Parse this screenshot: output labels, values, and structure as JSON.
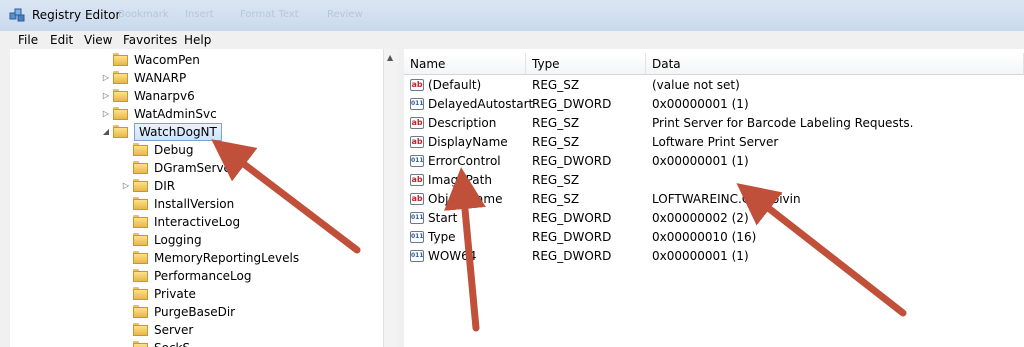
{
  "window": {
    "title": "Registry Editor",
    "ghost_tabs": [
      "Bookmark",
      "Insert",
      "Format Text",
      "Review"
    ]
  },
  "menu": [
    "File",
    "Edit",
    "View",
    "Favorites",
    "Help"
  ],
  "tree": {
    "items": [
      {
        "label": "WacomPen",
        "level": 1,
        "expander": "",
        "selected": false
      },
      {
        "label": "WANARP",
        "level": 1,
        "expander": "▷",
        "selected": false
      },
      {
        "label": "Wanarpv6",
        "level": 1,
        "expander": "▷",
        "selected": false
      },
      {
        "label": "WatAdminSvc",
        "level": 1,
        "expander": "▷",
        "selected": false
      },
      {
        "label": "WatchDogNT",
        "level": 1,
        "expander": "◢",
        "selected": true
      },
      {
        "label": "Debug",
        "level": 2,
        "expander": "",
        "selected": false
      },
      {
        "label": "DGramServer",
        "level": 2,
        "expander": "",
        "selected": false
      },
      {
        "label": "DIR",
        "level": 2,
        "expander": "▷",
        "selected": false
      },
      {
        "label": "InstallVersion",
        "level": 2,
        "expander": "",
        "selected": false
      },
      {
        "label": "InteractiveLog",
        "level": 2,
        "expander": "",
        "selected": false
      },
      {
        "label": "Logging",
        "level": 2,
        "expander": "",
        "selected": false
      },
      {
        "label": "MemoryReportingLevels",
        "level": 2,
        "expander": "",
        "selected": false
      },
      {
        "label": "PerformanceLog",
        "level": 2,
        "expander": "",
        "selected": false
      },
      {
        "label": "Private",
        "level": 2,
        "expander": "",
        "selected": false
      },
      {
        "label": "PurgeBaseDir",
        "level": 2,
        "expander": "",
        "selected": false
      },
      {
        "label": "Server",
        "level": 2,
        "expander": "",
        "selected": false
      },
      {
        "label": "SockS...",
        "level": 2,
        "expander": "",
        "selected": false
      }
    ]
  },
  "columns": {
    "name": "Name",
    "type": "Type",
    "data": "Data"
  },
  "values": [
    {
      "name": "(Default)",
      "type": "REG_SZ",
      "data": "(value not set)",
      "icon": "string-value-icon"
    },
    {
      "name": "DelayedAutostart",
      "type": "REG_DWORD",
      "data": "0x00000001 (1)",
      "icon": "binary-value-icon"
    },
    {
      "name": "Description",
      "type": "REG_SZ",
      "data": "Print Server for Barcode Labeling Requests.",
      "icon": "string-value-icon"
    },
    {
      "name": "DisplayName",
      "type": "REG_SZ",
      "data": "Loftware Print Server",
      "icon": "string-value-icon"
    },
    {
      "name": "ErrorControl",
      "type": "REG_DWORD",
      "data": "0x00000001 (1)",
      "icon": "binary-value-icon"
    },
    {
      "name": "ImagePath",
      "type": "REG_SZ",
      "data": "",
      "icon": "string-value-icon"
    },
    {
      "name": "ObjectName",
      "type": "REG_SZ",
      "data": "LOFTWAREINC.CO\\Boivin",
      "icon": "string-value-icon"
    },
    {
      "name": "Start",
      "type": "REG_DWORD",
      "data": "0x00000002 (2)",
      "icon": "binary-value-icon"
    },
    {
      "name": "Type",
      "type": "REG_DWORD",
      "data": "0x00000010 (16)",
      "icon": "binary-value-icon"
    },
    {
      "name": "WOW64",
      "type": "REG_DWORD",
      "data": "0x00000001 (1)",
      "icon": "binary-value-icon"
    }
  ],
  "annotation_color": "#c0503a"
}
